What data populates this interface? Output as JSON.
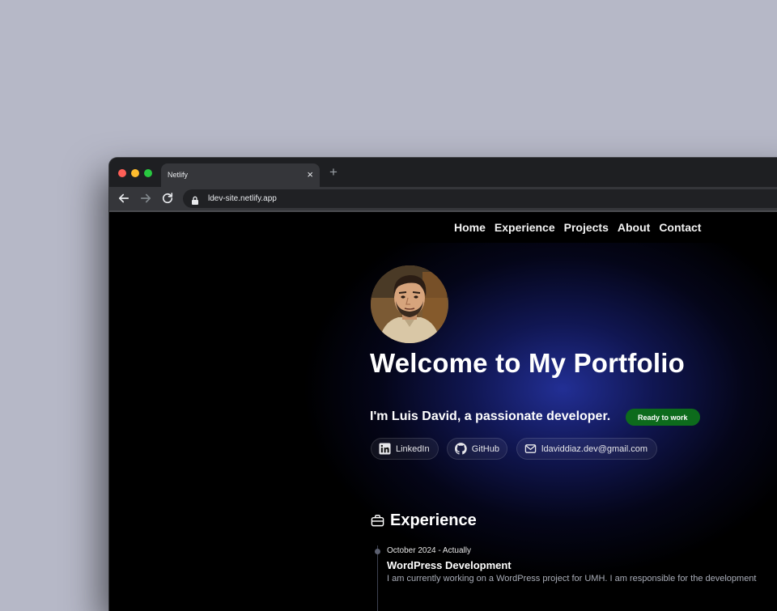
{
  "browser": {
    "tab_title": "Netlify",
    "tab_close": "×",
    "new_tab": "+",
    "url": "ldev-site.netlify.app"
  },
  "nav": {
    "links": [
      "Home",
      "Experience",
      "Projects",
      "About",
      "Contact"
    ]
  },
  "hero": {
    "title": "Welcome to My Portfolio",
    "subtitle": "I'm Luis David, a passionate developer.",
    "badge": "Ready to work",
    "socials": {
      "linkedin": "LinkedIn",
      "github": "GitHub",
      "email": "ldaviddiaz.dev@gmail.com"
    }
  },
  "experience": {
    "heading": "Experience",
    "items": [
      {
        "date": "October 2024 - Actually",
        "role": "WordPress Development",
        "description": "I am currently working on a WordPress project for UMH. I am responsible for the development"
      }
    ]
  },
  "colors": {
    "page_background": "#000000",
    "glow": "#2634a5",
    "badge": "#0d6b1c",
    "chrome_tabbar": "#1e1f22",
    "chrome_toolbar": "#35363a"
  }
}
